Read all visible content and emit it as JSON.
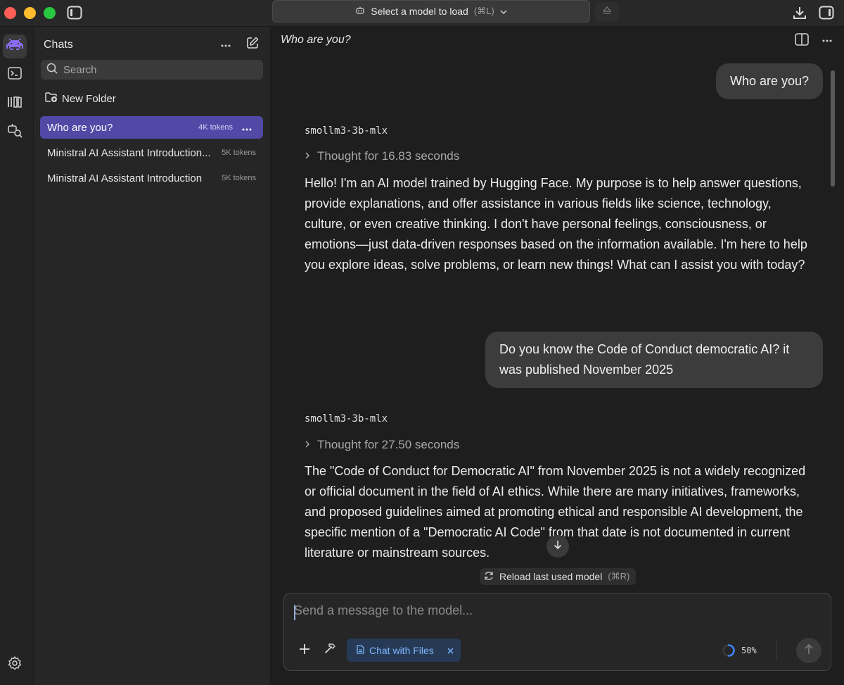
{
  "titlebar": {
    "model_select_label": "Select a model to load",
    "model_select_shortcut": "(⌘L)"
  },
  "sidebar": {
    "title": "Chats",
    "search_placeholder": "Search",
    "new_folder_label": "New Folder",
    "chats": [
      {
        "label": "Who are you?",
        "tokens": "4K tokens",
        "selected": true
      },
      {
        "label": "Ministral AI Assistant Introduction...",
        "tokens": "5K tokens",
        "selected": false
      },
      {
        "label": "Ministral AI Assistant Introduction",
        "tokens": "5K tokens",
        "selected": false
      }
    ]
  },
  "main": {
    "title": "Who are you?",
    "messages": [
      {
        "role": "user",
        "text": "Who are you?"
      },
      {
        "role": "assistant",
        "model": "smollm3-3b-mlx",
        "thought": "Thought for 16.83 seconds",
        "text": "Hello! I'm an AI model trained by Hugging Face. My purpose is to help answer questions, provide explanations, and offer assistance in various fields like science, technology, culture, or even creative thinking. I don't have personal feelings, consciousness, or emotions—just data-driven responses based on the information available. I'm here to help you explore ideas, solve problems, or learn new things! What can I assist you with today?"
      },
      {
        "role": "user",
        "text": "Do you know the Code of Conduct democratic AI? it was published November 2025"
      },
      {
        "role": "assistant",
        "model": "smollm3-3b-mlx",
        "thought": "Thought for 27.50 seconds",
        "text": "The \"Code of Conduct for Democratic AI\" from November 2025 is not a widely recognized or official document in the field of AI ethics. While there are many initiatives, frameworks, and proposed guidelines aimed at promoting ethical and responsible AI development, the specific mention of a \"Democratic AI Code\" from that date is not documented in current literature or mainstream sources."
      }
    ],
    "reload_label": "Reload last used model",
    "reload_shortcut": "(⌘R)"
  },
  "composer": {
    "placeholder": "Send a message to the model...",
    "chip_label": "Chat with Files",
    "context_usage": "50%",
    "context_fraction": 0.5
  },
  "colors": {
    "accent": "#5248a6",
    "chip_text": "#7fb6ff",
    "rail_logo": "#8b6cf0"
  }
}
